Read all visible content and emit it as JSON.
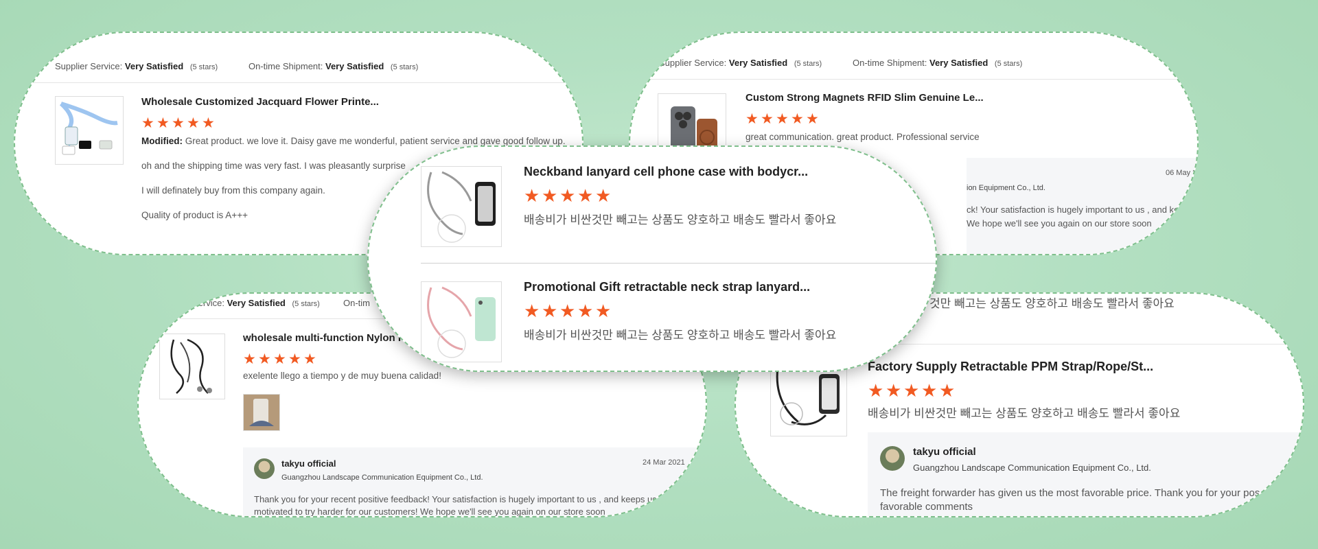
{
  "colors": {
    "background": "#b3e0c2",
    "accent_star": "#f15a22",
    "bubble_border": "#7fbf8c"
  },
  "star_icon": "star-icon",
  "rating_stars": 5,
  "card_top_left": {
    "supplier_label": "Supplier Service:",
    "supplier_value": "Very Satisfied",
    "supplier_stars": "(5 stars)",
    "shipment_label": "On-time Shipment:",
    "shipment_value": "Very Satisfied",
    "shipment_stars": "(5 stars)",
    "product_title": "Wholesale Customized Jacquard Flower Printe...",
    "modified_label": "Modified:",
    "line1": "Great product. we love it. Daisy gave me wonderful, patient service and gave good follow up.",
    "line2": "oh and the shipping time was very fast. I was pleasantly surprise",
    "line3": "I will definately buy from this company again.",
    "line4": "Quality of product is A+++"
  },
  "card_top_right": {
    "supplier_label": "Supplier Service:",
    "supplier_value": "Very Satisfied",
    "supplier_stars": "(5 stars)",
    "shipment_label": "On-time Shipment:",
    "shipment_value": "Very Satisfied",
    "shipment_stars": "(5 stars)",
    "product_title": "Custom Strong Magnets RFID Slim Genuine Le...",
    "review": "great communication. great product. Professional service",
    "reply_date": "06 May 20",
    "reply_company": "ion Equipment Co., Ltd.",
    "reply_line1": "ck! Your satisfaction is hugely important to us , and keeps us",
    "reply_line2": "We hope we'll see you again on our store  soon"
  },
  "card_center": {
    "item1_title": "Neckband lanyard cell phone case with bodycr...",
    "item1_review": "배송비가 비싼것만 빼고는 상품도 양호하고 배송도 빨라서 좋아요",
    "item2_title": "Promotional Gift retractable neck strap lanyard...",
    "item2_review": "배송비가 비싼것만 빼고는 상품도 양호하고 배송도 빨라서 좋아요"
  },
  "card_bottom_left": {
    "supplier_label": "Service:",
    "supplier_value": "Very Satisfied",
    "supplier_stars": "(5 stars)",
    "shipment_label": "On-tim",
    "product_title": "wholesale multi-function Nylon R",
    "review": "exelente llego a tiempo y de muy buena calidad!",
    "reply_name": "takyu official",
    "reply_company": "Guangzhou Landscape Communication Equipment Co., Ltd.",
    "reply_date": "24 Mar 2021",
    "reply_line1": "Thank you for your recent positive feedback! Your satisfaction is hugely important to us , and keeps us",
    "reply_line2": "motivated to try harder for our customers! We hope we'll see you again on our store  soon"
  },
  "card_bottom_right": {
    "top_review": "것만 빼고는 상품도 양호하고 배송도 빨라서 좋아요",
    "product_title": "Factory Supply Retractable PPM Strap/Rope/St...",
    "review": "배송비가 비싼것만 빼고는 상품도 양호하고 배송도 빨라서 좋아요",
    "reply_name": "takyu official",
    "reply_company": "Guangzhou Landscape Communication Equipment Co., Ltd.",
    "reply_line1": "The freight forwarder has given us the most favorable price. Thank you for your pos",
    "reply_line2": "favorable comments"
  }
}
